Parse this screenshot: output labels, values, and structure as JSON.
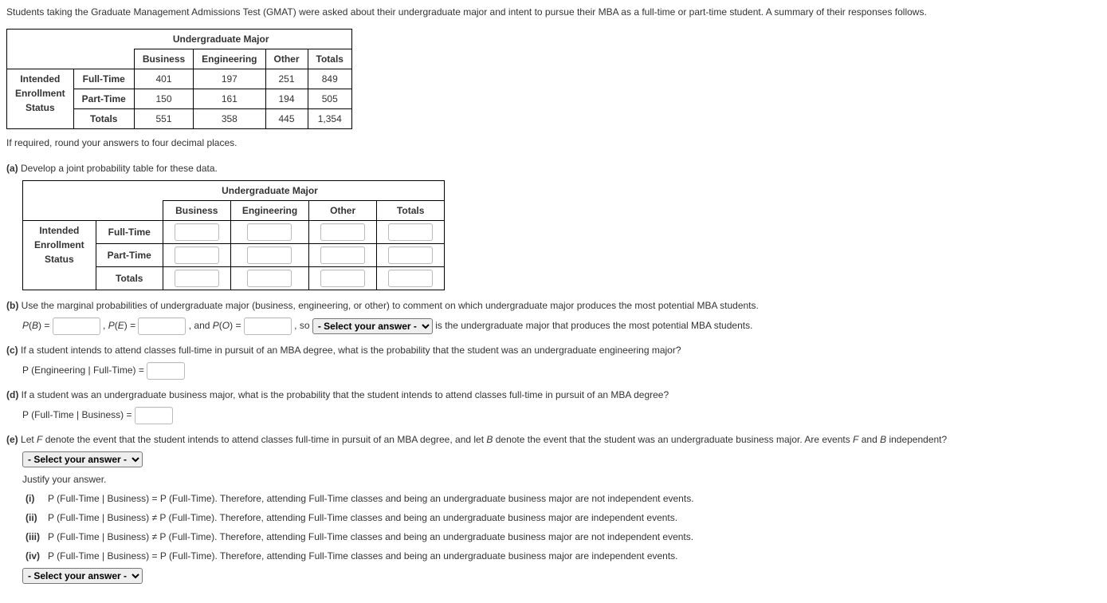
{
  "intro": "Students taking the Graduate Management Admissions Test (GMAT) were asked about their undergraduate major and intent to pursue their MBA as a full-time or part-time student. A summary of their responses follows.",
  "table1": {
    "superheader": "Undergraduate Major",
    "cols": [
      "Business",
      "Engineering",
      "Other",
      "Totals"
    ],
    "rowgroup": [
      "Intended",
      "Enrollment",
      "Status"
    ],
    "rows": [
      {
        "label": "Full-Time",
        "cells": [
          "401",
          "197",
          "251",
          "849"
        ]
      },
      {
        "label": "Part-Time",
        "cells": [
          "150",
          "161",
          "194",
          "505"
        ]
      },
      {
        "label": "Totals",
        "cells": [
          "551",
          "358",
          "445",
          "1,354"
        ]
      }
    ]
  },
  "round_note": "If required, round your answers to four decimal places.",
  "a": {
    "label": "(a)",
    "text": "Develop a joint probability table for these data.",
    "superheader": "Undergraduate Major",
    "cols": [
      "Business",
      "Engineering",
      "Other",
      "Totals"
    ],
    "rowgroup": [
      "Intended",
      "Enrollment",
      "Status"
    ],
    "rowlabels": [
      "Full-Time",
      "Part-Time",
      "Totals"
    ]
  },
  "b": {
    "label": "(b)",
    "text": "Use the marginal probabilities of undergraduate major (business, engineering, or other) to comment on which undergraduate major produces the most potential MBA students.",
    "pb": "P(B) = ",
    "pe": ", P(E) = ",
    "po": ", and P(O) = ",
    "so": ", so",
    "select": "- Select your answer -",
    "tail": "is the undergraduate major that produces the most potential MBA students."
  },
  "c": {
    "label": "(c)",
    "text": "If a student intends to attend classes full-time in pursuit of an MBA degree, what is the probability that the student was an undergraduate engineering major?",
    "formula": "P (Engineering | Full-Time) ="
  },
  "d": {
    "label": "(d)",
    "text": "If a student was an undergraduate business major, what is the probability that the student intends to attend classes full-time in pursuit of an MBA degree?",
    "formula": "P (Full-Time | Business) ="
  },
  "e": {
    "label": "(e)",
    "text_pre": "Let ",
    "F": "F",
    "text_mid1": " denote the event that the student intends to attend classes full-time in pursuit of an MBA degree, and let ",
    "B": "B",
    "text_mid2": " denote the event that the student was an undergraduate business major. Are events ",
    "text_and": " and ",
    "text_end": " independent?",
    "select": "- Select your answer -",
    "justify": "Justify your answer.",
    "items": [
      {
        "roman": "(i)",
        "text": "P (Full-Time | Business) = P (Full-Time). Therefore, attending Full-Time classes and being an undergraduate business major are not independent events."
      },
      {
        "roman": "(ii)",
        "text": "P (Full-Time | Business) ≠ P (Full-Time). Therefore, attending Full-Time classes and being an undergraduate business major are independent events."
      },
      {
        "roman": "(iii)",
        "text": "P (Full-Time | Business) ≠ P (Full-Time). Therefore, attending Full-Time classes and being an undergraduate business major are not independent events."
      },
      {
        "roman": "(iv)",
        "text": "P (Full-Time | Business) = P (Full-Time). Therefore, attending Full-Time classes and being an undergraduate business major are independent events."
      }
    ],
    "select2": "- Select your answer -"
  }
}
